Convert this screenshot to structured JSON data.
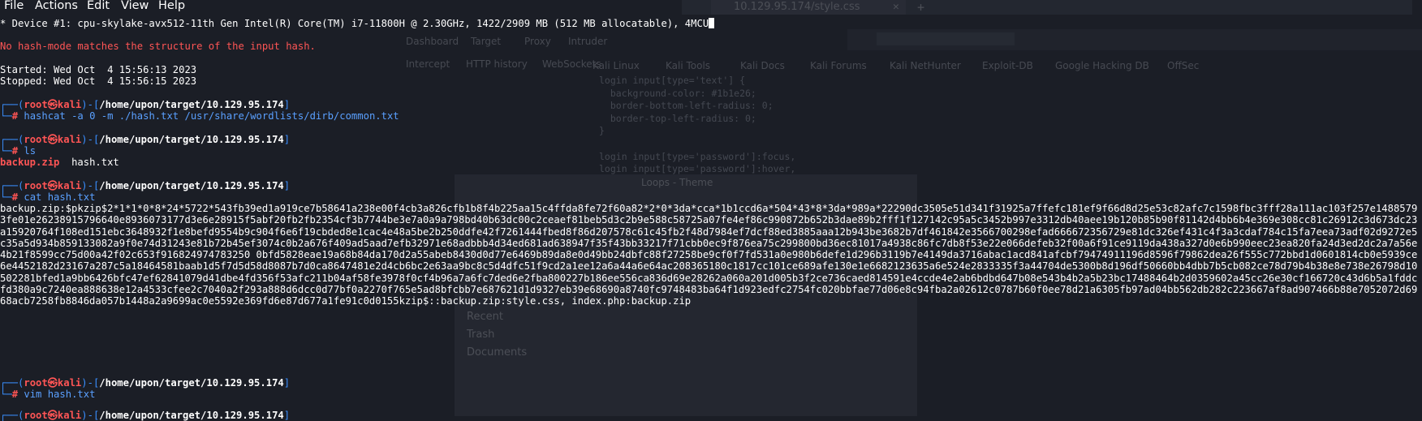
{
  "menubar": {
    "items": [
      "File",
      "Actions",
      "Edit",
      "View",
      "Help"
    ]
  },
  "background_window": {
    "tab_title": "10.129.95.174/style.css",
    "burp_tabs": [
      "Dashboard",
      "Target",
      "Proxy",
      "Intruder"
    ],
    "burp_subtabs": [
      "Intercept",
      "HTTP history",
      "WebSockets"
    ],
    "bookmarks": [
      "Kali Linux",
      "Kali Tools",
      "Kali Docs",
      "Kali Forums",
      "Kali NetHunter",
      "Exploit-DB",
      "Google Hacking DB",
      "OffSec"
    ],
    "code_lines": [
      "login input[type='text'] {",
      "  background-color: #1b1e26;",
      "  border-bottom-left-radius: 0;",
      "  border-top-left-radius: 0;",
      "}",
      "",
      "login input[type='password']:focus,",
      "login input[type='password']:hover,"
    ],
    "panel_title": "Loops - Theme",
    "side_items": [
      "Recent",
      "Trash",
      "Documents"
    ]
  },
  "terminal": {
    "device_line": "* Device #1: cpu-skylake-avx512-11th Gen Intel(R) Core(TM) i7-11800H @ 2.30GHz, 1422/2909 MB (512 MB allocatable), 4MCU",
    "error_line": "No hash-mode matches the structure of the input hash.",
    "started": "Started: Wed Oct  4 15:56:13 2023",
    "stopped": "Stopped: Wed Oct  4 15:56:15 2023",
    "prompt_user": "root",
    "prompt_host": "kali",
    "prompt_path": "/home/upon/target/10.129.95.174",
    "commands": [
      "hashcat -a 0 -m ./hash.txt /usr/share/wordlists/dirb/common.txt",
      "ls",
      "cat hash.txt",
      "vim hash.txt"
    ],
    "ls_output": {
      "zip": "backup.zip",
      "txt": "hash.txt"
    },
    "hash_output": "backup.zip:$pkzip$2*1*1*0*8*24*5722*543fb39ed1a919ce7b58641a238e00f4cb3a826cfb1b8f4b225aa15c4ffda8fe72f60a82*2*0*3da*cca*1b1ccd6a*504*43*8*3da*989a*22290dc3505e51d341f31925a7ffefc181ef9f66d8d25e53c82afc7c1598fbc3fff28a111ac103f257e14885793fe01e26238915796640e8936073177d3e6e28915f5abf20fb2fb2354cf3b7744be3e7a0a9a798bd40b63dc00c2ceaef81beb5d3c2b9e588c58725a07fe4ef86c990872b652b3dae89b2fff1f127142c95a5c3452b997e3312db40aee19b120b85b90f81142d4bb6b4e369e308cc81c26912c3d673dc23a15920764f108ed151ebc3648932f1e8befd9554b9c904f6e6f19cbded8e1cac4e48a5be2b250ddfe42f7261444fbed8f86d207578c61c45fb2f48d7984ef7dcf88ed3885aaa12b943be3682b7df461842e3566700298efad666672356729e81dc326ef431c4f3a3cdaf784c15fa7eea73adf02d9272e5c35a5d934b859133082a9f0e74d31243e81b72b45ef3074c0b2a676f409ad5aad7efb32971e68adbbb4d34ed681ad638947f35f43bb33217f71cbb0ec9f876ea75c299800bd36ec81017a4938c86fc7db8f53e22e066defeb32f00a6f91ce9119da438a327d0e6b990eec23ea820fa24d3ed2dc2a7a56e4b21f8599cc75d00a42f02c653f916824974783250 0bfd5828eae19a68b84da170d2a55abeb8430d0d77e6469b89da8e0d49bb24dbfc88f27258be9cf0f7fd531a0e980b6defe1d296b3119b7e4149da3716abac1acd841afcbf79474911196d8596f79862dea26f555c772bbd1d0601814cb0e5939ce6e4452182d23167a287c5a18464581baab1d5f7d5d58d8087b7d0ca8647481e2d4cb6bc2e63aa9bc8c5d4dfc51f9cd2a1ee12a6a44a6e64ac208365180c1817cc101ce689afe130e1e6682123635a6e524e2833335f3a44704de5300b8d196df50660bb4dbb7b5cb082ce78d79b4b38e8e738e26798d10502281bfed1a9bb6426bfc47ef62841079d41dbe4fd356f53afc211b04af58fe3978f0cf4b96a7a6fc7ded6e2fba800227b186ee556ca836d69e28262a060a201d005b3f2ce736caed814591e4ccde4e2ab6bdbd647b08e543b4b2a5b23bc17488464b2d0359602a45cc26e30cf166720c43d6b5a1fddcfd380a9c7240ea888638e12a4533cfee2c7040a2f293a888d6dcc0d77bf0a2270f765e5ad8bfcbb7e687621d1d9327eb39e68690a8740fc9748483ba64f1d923edfc2754fc020bbfae77d06e8c94fba2a02612c0787b60f0ee78d21a6305fb97ad04bb562db282c223667af8ad907466b88e7052072d6968acb7258fb8846da057b1448a2a9699ac0e5592e369fd6e87d677a1fe91c0d0155kzip$::backup.zip:style.css, index.php:backup.zip"
  },
  "colors": {
    "background": "#1b1e26",
    "prompt_blue": "#3a8fff",
    "prompt_red": "#ff5555",
    "error_red": "#ff5555"
  }
}
